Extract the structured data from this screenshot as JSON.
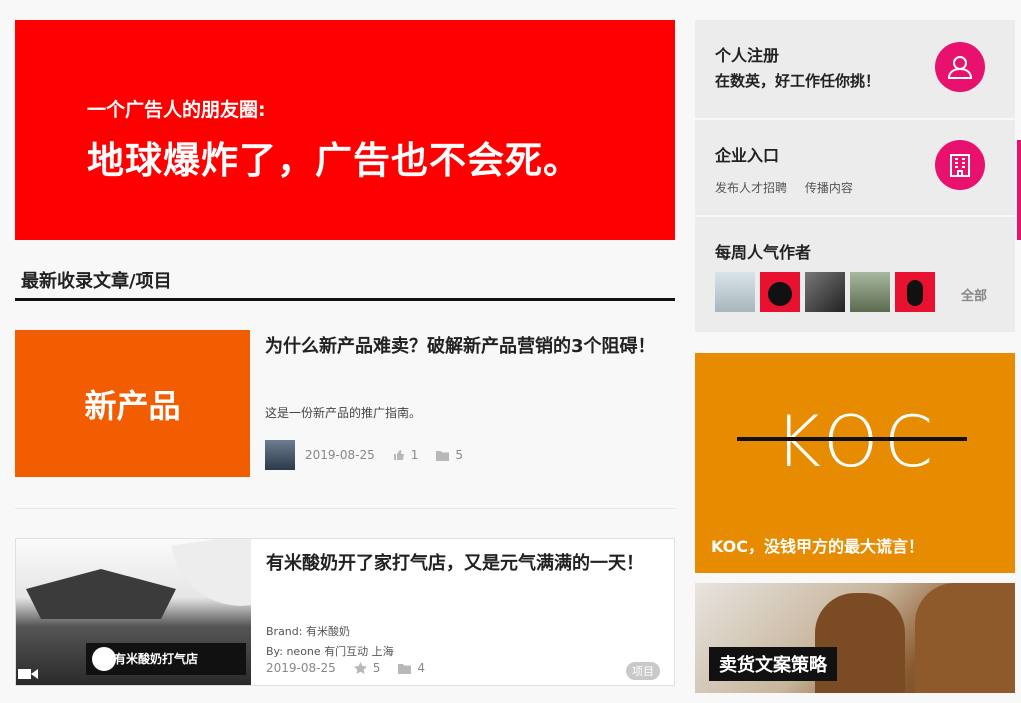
{
  "banner": {
    "sub": "一个广告人的朋友圈:",
    "main": "地球爆炸了，广告也不会死。"
  },
  "section": {
    "title": "最新收录文章/项目"
  },
  "articles": [
    {
      "thumb_text": "新产品",
      "title": "为什么新产品难卖？破解新产品营销的3个阻碍！",
      "desc": "这是一份新产品的推广指南。",
      "date": "2019-08-25",
      "likes": "1",
      "folders": "5"
    },
    {
      "thumb_sign": "有米酸奶打气店",
      "title": "有米酸奶开了家打气店，又是元气满满的一天！",
      "brand": "Brand: 有米酸奶",
      "by": "By: neone 有门互动 上海",
      "date": "2019-08-25",
      "stars": "5",
      "folders": "4",
      "tag": "项目"
    }
  ],
  "sidebar": {
    "register_title": "个人注册",
    "register_sub": "在数英，好工作任你挑！",
    "company_title": "企业入口",
    "company_links": [
      "发布人才招聘",
      "传播内容"
    ],
    "popular_title": "每周人气作者",
    "all_label": "全部",
    "accent": "#e8116e"
  },
  "promos": {
    "koc_big": "KOC",
    "koc_caption": "KOC，没钱甲方的最大谎言！",
    "boots_label": "卖货文案策略"
  },
  "colors": {
    "banner": "#fe0000",
    "new_product": "#f35d02",
    "koc": "#e78c01"
  }
}
